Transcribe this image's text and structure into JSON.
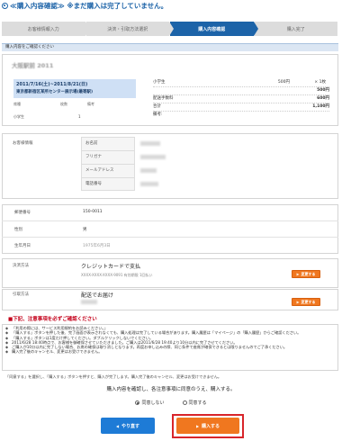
{
  "page": {
    "title": "≪購入内容確認≫ ※まだ購入は完了していません。"
  },
  "steps": [
    {
      "label": "お客様情報入力",
      "active": false
    },
    {
      "label": "決済・引取方法選択",
      "active": false
    },
    {
      "label": "購入内容確認",
      "active": true
    },
    {
      "label": "購入完了",
      "active": false
    }
  ],
  "section": {
    "heading": "購入内容をご確認ください"
  },
  "order": {
    "shop_name": "大阪駅前 2011",
    "date_range": "2011/7/16(土)~2011/8/21(日)",
    "venue": "東京都新宿区某所センター展示場(最寄駅)",
    "columns": [
      "席種",
      "枚数",
      "備考"
    ],
    "row": {
      "seat": "小学生",
      "qty": "1"
    },
    "product": {
      "name": "小学生",
      "unit_price": "500円",
      "mult": "× 1枚"
    },
    "totals": [
      {
        "label": "",
        "value": "500円"
      },
      {
        "label": "配送手数料",
        "value": "600円"
      },
      {
        "label": "合計",
        "value": "1,100円"
      },
      {
        "label": "備考:",
        "value": ""
      }
    ]
  },
  "customer": {
    "label": "お客様情報",
    "fields": [
      "お名前",
      "フリガナ",
      "メールアドレス",
      "電話番号"
    ]
  },
  "address": [
    {
      "label": "郵便番号",
      "value": "150-0011"
    },
    {
      "label": "性別",
      "value": "男"
    },
    {
      "label": "生年月日",
      "value": "1975年6月3日"
    }
  ],
  "payment": {
    "label": "決済方法",
    "title": "クレジットカードで支払",
    "detail": "XXXX-XXXX-XXXX-9091 有効期限 1回払い",
    "change_label": "変更する"
  },
  "delivery": {
    "label": "引取方法",
    "title": "配送でお届け",
    "change_label": "変更する"
  },
  "notes": {
    "title": "■下記、注意事項を必ずご確認ください",
    "items": [
      "「利用の際には、サービス利用規約をお読みください。」",
      "「購入する」ボタンを押した後、完了画面が表示されなくても、購入処理は完了している場合があります。購入履歴は「マイページ」の「購入履歴」からご確認ください。",
      "「購入する」ボタンは1度だけ押してください。ダブルクリックしないでください。",
      "2011/6/28 18:40時点で、お客様を御確保させていただきました。ご購入は2011/6/28 19:40より10分以内に完了させてください。",
      "ご購入が10分以内に完了しない場合、お席の確保は取り消しとなります。再度お申し込みの際、同じ条件で座席が確保できるとは限りませんのでご了承ください。",
      "購入完了後のキャンセル、変更はお受けできません。"
    ]
  },
  "confirm": {
    "note": "「同意する」を選択し、「購入する」ボタンを押すと、購入が完了します。購入完了後のキャンセル、変更はお受けできません。",
    "agree_text": "購入内容を確認し、各注意事項に同意のうえ、購入する。",
    "agree_label": "同意しない",
    "disagree_label": "同意する"
  },
  "buttons": {
    "back": "やり直す",
    "buy": "購入する"
  },
  "colors": {
    "brand": "#1c63a8",
    "accent": "#f0771f",
    "highlight": "#d8252a"
  }
}
